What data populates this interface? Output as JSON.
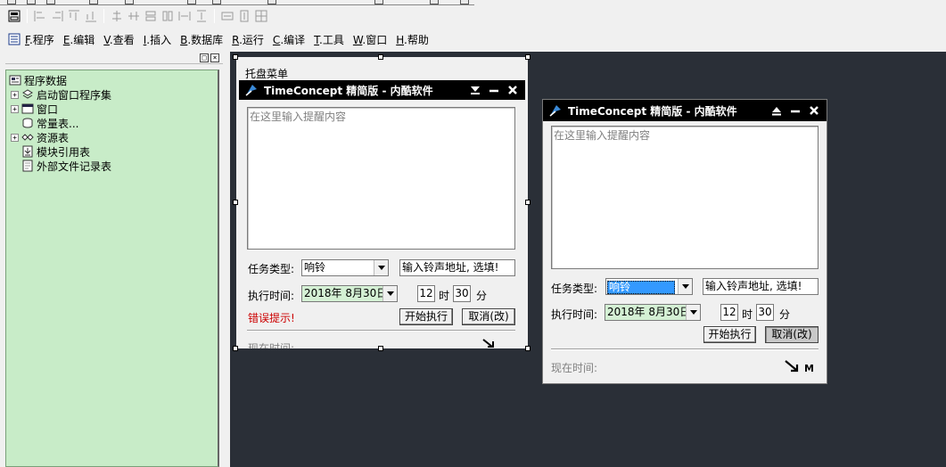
{
  "menubar": {
    "items": [
      {
        "key": "F",
        "label": ".程序"
      },
      {
        "key": "E",
        "label": ".编辑"
      },
      {
        "key": "V",
        "label": ".查看"
      },
      {
        "key": "I",
        "label": ".插入"
      },
      {
        "key": "B",
        "label": ".数据库"
      },
      {
        "key": "R",
        "label": ".运行"
      },
      {
        "key": "C",
        "label": ".编译"
      },
      {
        "key": "T",
        "label": ".工具"
      },
      {
        "key": "W",
        "label": ".窗口"
      },
      {
        "key": "H",
        "label": ".帮助"
      }
    ]
  },
  "tree": {
    "root": "程序数据",
    "items": [
      "启动窗口程序集",
      "窗口",
      "常量表...",
      "资源表",
      "模块引用表",
      "外部文件记录表"
    ]
  },
  "designer": {
    "tray_menu_label": "托盘菜单",
    "title": "TimeConcept 精简版 - 内酷软件",
    "placeholder": "在这里输入提醒内容",
    "task_type_label": "任务类型:",
    "task_type_value": "响铃",
    "sound_path": "输入铃声地址, 选填!",
    "exec_time_label": "执行时间:",
    "date_value": "2018年 8月30日",
    "hour_value": "12",
    "hour_unit": "时",
    "minute_value": "30",
    "minute_unit": "分",
    "error_label": "错误提示!",
    "start_button": "开始执行",
    "cancel_button": "取消(改)",
    "current_time_label": "现在时间:"
  },
  "runtime": {
    "title": "TimeConcept 精简版 - 内酷软件",
    "placeholder": "在这里输入提醒内容",
    "task_type_label": "任务类型:",
    "task_type_value": "响铃",
    "sound_path": "输入铃声地址, 选填!",
    "exec_time_label": "执行时间:",
    "date_value": "2018年 8月30日",
    "hour_value": "12",
    "hour_unit": "时",
    "minute_value": "30",
    "minute_unit": "分",
    "start_button": "开始执行",
    "cancel_button": "取消(改)",
    "current_time_label": "现在时间:",
    "brand_letter": "M"
  },
  "colors": {
    "tree_bg": "#c8ecc8",
    "design_bg": "#2a2f37",
    "titlebar_bg": "#000000",
    "error_text": "#cc0000",
    "selection": "#3399ff"
  }
}
